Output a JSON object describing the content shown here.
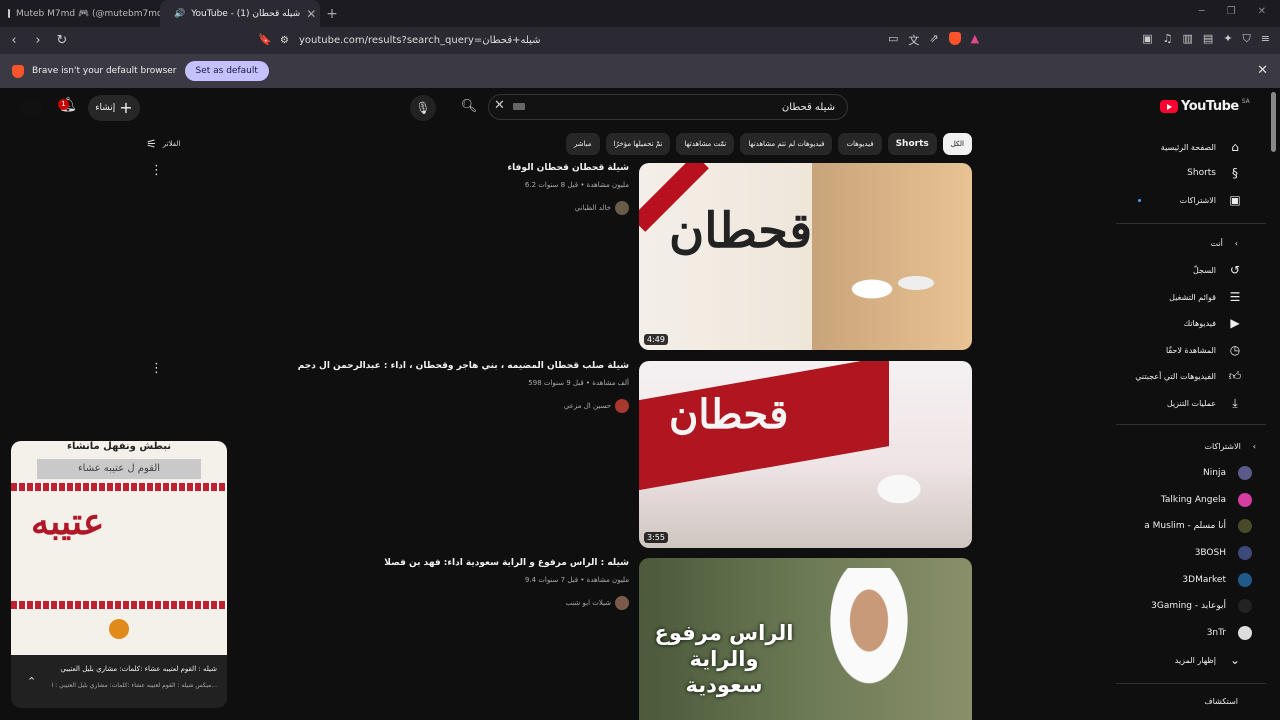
{
  "browser": {
    "tabs": [
      {
        "title": "Muteb M7md 🎮 (@mutebm7md)"
      },
      {
        "title": "YouTube - (1) شيله قحطان"
      }
    ],
    "url": "youtube.com/results?search_query=شيله+قحطان",
    "info_text": "Brave isn't your default browser",
    "info_button": "Set as default"
  },
  "yt": {
    "logo": "YouTube",
    "region": "SA",
    "search_query": "شيله قحطان",
    "create_label": "إنشاء",
    "notif_count": "1",
    "filters_label": "الفلاتر",
    "chips": [
      "الكل",
      "Shorts",
      "فيديوهات",
      "فيديوهات لم تتم مشاهدتها",
      "تمّت مشاهدتها",
      "تمّ تحميلها مؤخرًا",
      "مباشر"
    ]
  },
  "guide": {
    "main": [
      "الصفحة الرئيسية",
      "Shorts",
      "الاشتراكات"
    ],
    "you_header": "أنت",
    "you_items": [
      "السجلّ",
      "قوائم التشغيل",
      "فيديوهاتك",
      "المشاهدة لاحقًا",
      "الفيديوهات التي أعجبتني",
      "عمليات التنزيل"
    ],
    "subs_header": "الاشتراكات",
    "subs": [
      "Ninja",
      "Talking Angela",
      "أنا مسلم - a Muslim",
      "3BOSH",
      "3DMarket",
      "أبوعابد - 3Gaming",
      "3nTr"
    ],
    "show_more": "إظهار المزيد",
    "explore": "استكشاف"
  },
  "results": [
    {
      "title": "شيلة قحطان قحطان الوفاء",
      "meta": "6.2 مليون مشاهدة • قبل 8 سنوات",
      "channel": "خالد الظباني",
      "duration": "4:49",
      "thumb_text": "قحطان"
    },
    {
      "title": "شيلة صلب قحطان المضيمه ، بني هاجر وقحطان ، اداء : عبدالرحمن ال دجم",
      "meta": "598 ألف مشاهدة • قبل 9 سنوات",
      "channel": "حسين ال مزعي",
      "duration": "3:55",
      "thumb_text": "قحطان"
    },
    {
      "title": "شيله : الراس مرفوع و الراية سعودية اداء: فهد بن فصلا",
      "meta": "9.4 مليون مشاهدة • قبل 7 سنوات",
      "channel": "شيلات ابو شنب",
      "duration": "",
      "thumb_text": "الراس مرفوع والراية سعودية"
    }
  ],
  "miniplayer": {
    "title": "شيله : القوم لعتيبه عشاء :كلمات: مشاري بليل العتيبي",
    "subtitle": "ميكس شيله : القوم لعتيبه عشاء :كلمات: مشاري بليل العتيبي : ا...",
    "pic_text": "عتيبه",
    "pic_top": "نبطش ونفهل مانشاء",
    "pic_sub": "القوم ل عتيبه عشاء"
  }
}
